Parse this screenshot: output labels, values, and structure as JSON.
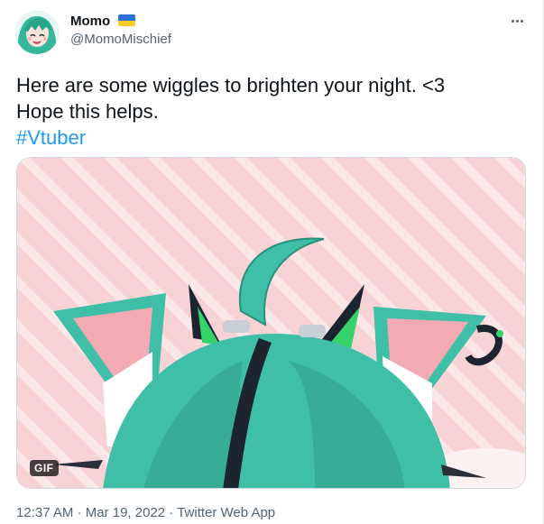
{
  "author": {
    "display_name": "Momo",
    "handle": "@MomoMischief"
  },
  "tweet": {
    "line1": "Here are some wiggles to brighten your night. <3",
    "line2": "Hope this helps.",
    "hashtag": "#Vtuber"
  },
  "media": {
    "badge": "GIF"
  },
  "meta": {
    "time": "12:37 AM",
    "date": "Mar 19, 2022",
    "source": "Twitter Web App",
    "separator": "·"
  },
  "colors": {
    "accent": "#1d9bf0",
    "hair": "#3fbfa8",
    "background_pink": "#f9d6d8"
  },
  "icons": [
    "more-options-icon",
    "ukraine-flag-icon"
  ]
}
